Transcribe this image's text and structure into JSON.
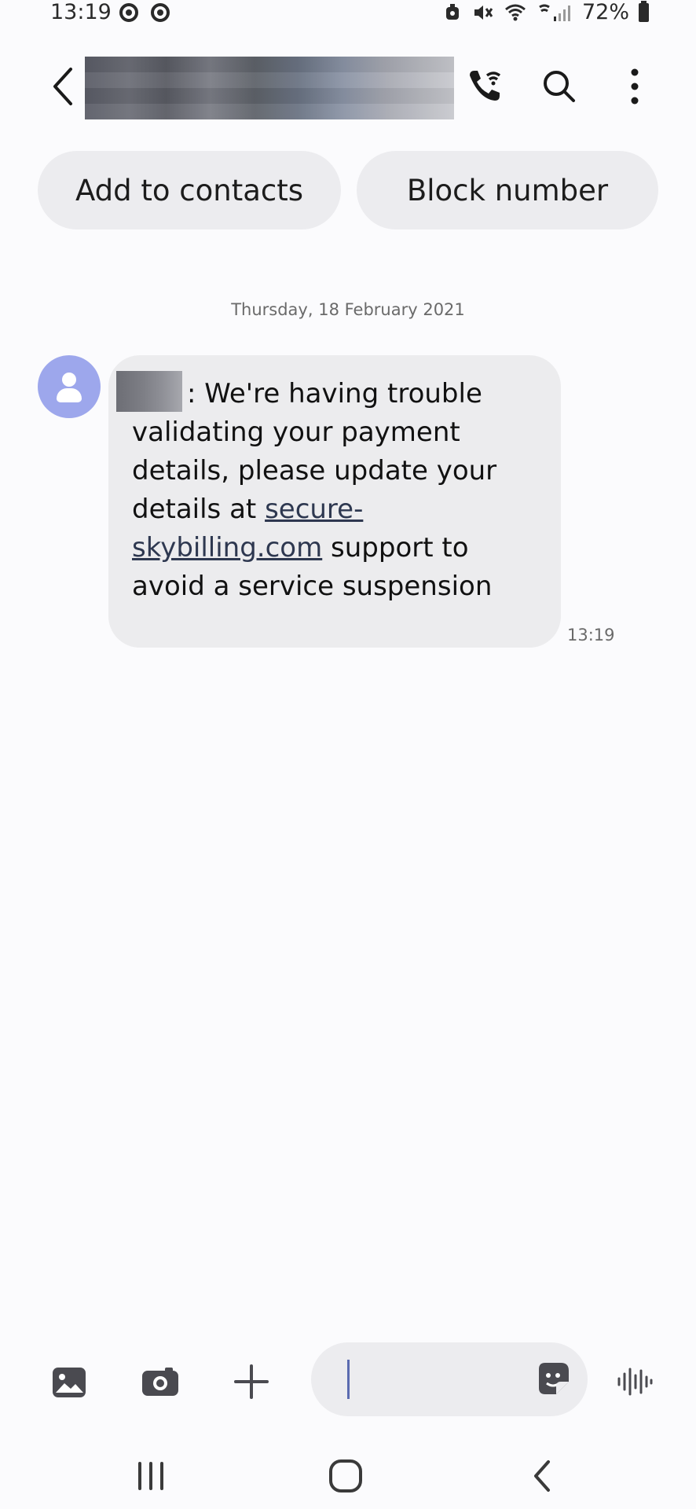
{
  "status_bar": {
    "time": "13:19",
    "battery": "72%"
  },
  "header": {
    "contact_name": ""
  },
  "actions": {
    "add_to_contacts": "Add to contacts",
    "block_number": "Block number"
  },
  "conversation": {
    "date": "Thursday, 18 February 2021",
    "message": {
      "sender": "",
      "text_before_link": ": We're having trouble validating your payment details, please update your details at ",
      "link": "secure-skybilling.com",
      "text_after_link": " support to avoid a service suspension",
      "time": "13:19"
    }
  },
  "composer": {
    "input_value": ""
  },
  "colors": {
    "accent": "#9da7ec",
    "bubble": "#ececee",
    "link": "#2e3850"
  },
  "icons": [
    "back-icon",
    "wifi-call-icon",
    "search-icon",
    "more-icon",
    "gallery-icon",
    "camera-icon",
    "add-icon",
    "sticker-icon",
    "voice-icon",
    "recents-icon",
    "home-icon",
    "nav-back-icon"
  ]
}
